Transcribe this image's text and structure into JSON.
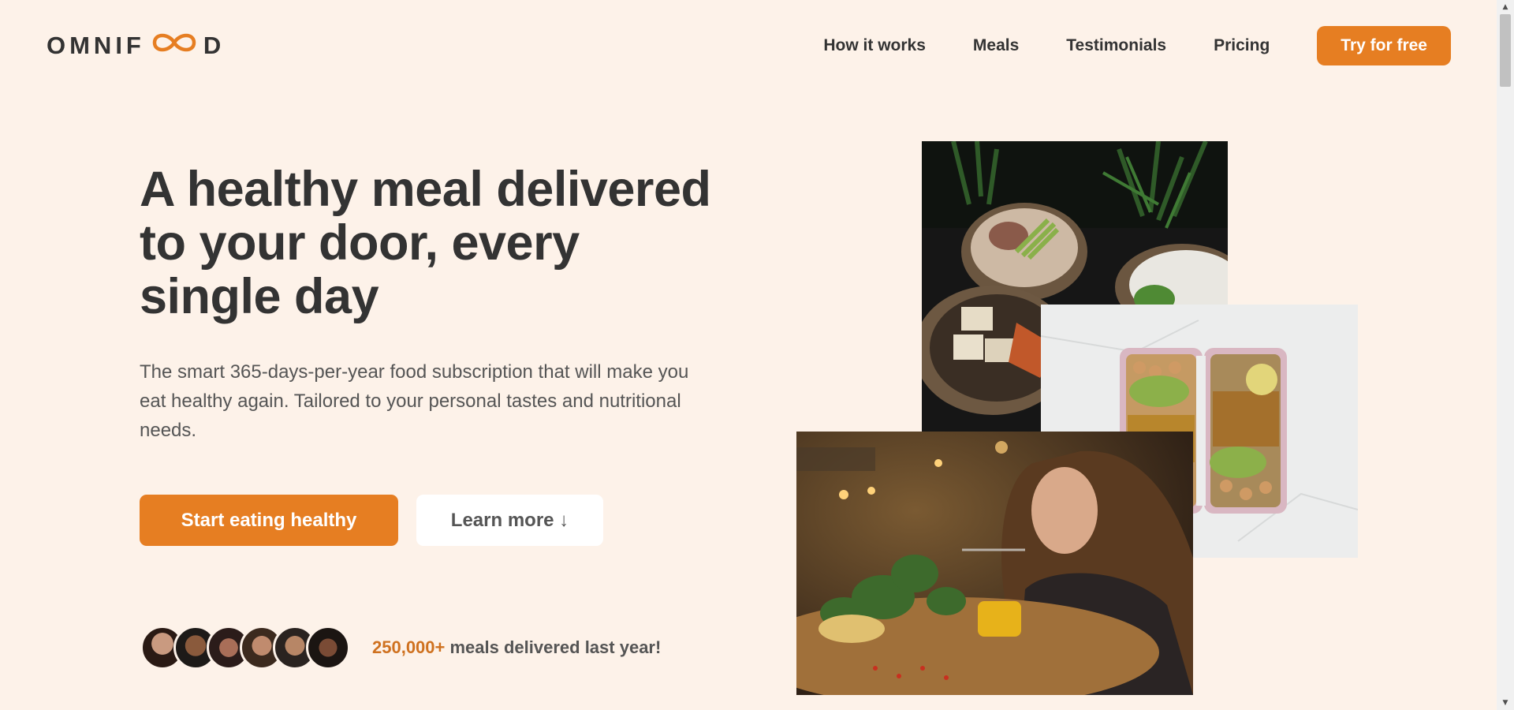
{
  "header": {
    "logo_left": "OMNIF",
    "logo_right": "D",
    "nav": [
      {
        "label": "How it works"
      },
      {
        "label": "Meals"
      },
      {
        "label": "Testimonials"
      },
      {
        "label": "Pricing"
      }
    ],
    "cta_label": "Try for free"
  },
  "hero": {
    "title": "A healthy meal delivered to your door, every single day",
    "description": "The smart 365-days-per-year food subscription that will make you eat healthy again. Tailored to your personal tastes and nutritional needs.",
    "primary_button": "Start eating healthy",
    "secondary_button": "Learn more ↓",
    "delivered_count": "250,000+",
    "delivered_text": " meals delivered last year!"
  },
  "colors": {
    "brand": "#e67e22",
    "brand_dark": "#cf711f",
    "background": "#fdf2e9",
    "text": "#333333"
  },
  "icons": {
    "logo": "infinity-icon",
    "scroll_up": "triangle-up-icon",
    "scroll_down": "triangle-down-icon"
  }
}
